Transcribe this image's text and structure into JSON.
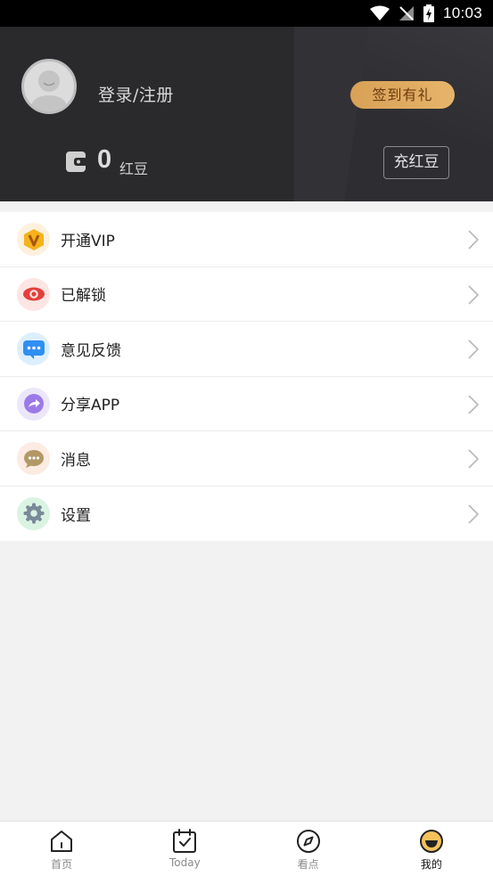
{
  "status_bar": {
    "time": "10:03"
  },
  "header": {
    "login_label": "登录/注册",
    "signin_button": "签到有礼",
    "beans_count": "0",
    "beans_unit": "红豆",
    "recharge_button": "充红豆"
  },
  "menu": {
    "items": [
      {
        "label": "开通VIP",
        "icon": "vip-icon"
      },
      {
        "label": "已解锁",
        "icon": "eye-icon"
      },
      {
        "label": "意见反馈",
        "icon": "feedback-icon"
      },
      {
        "label": "分享APP",
        "icon": "share-icon"
      },
      {
        "label": "消息",
        "icon": "message-icon"
      },
      {
        "label": "设置",
        "icon": "settings-icon"
      }
    ]
  },
  "tabbar": {
    "tabs": [
      {
        "label": "首页",
        "icon": "home-icon"
      },
      {
        "label": "Today",
        "icon": "calendar-check-icon"
      },
      {
        "label": "看点",
        "icon": "compass-icon"
      },
      {
        "label": "我的",
        "icon": "profile-icon",
        "active": true
      }
    ]
  },
  "colors": {
    "header_bg": "#2a2a2d",
    "signin_gold": "#e0aa60",
    "page_bg": "#f2f2f2"
  }
}
